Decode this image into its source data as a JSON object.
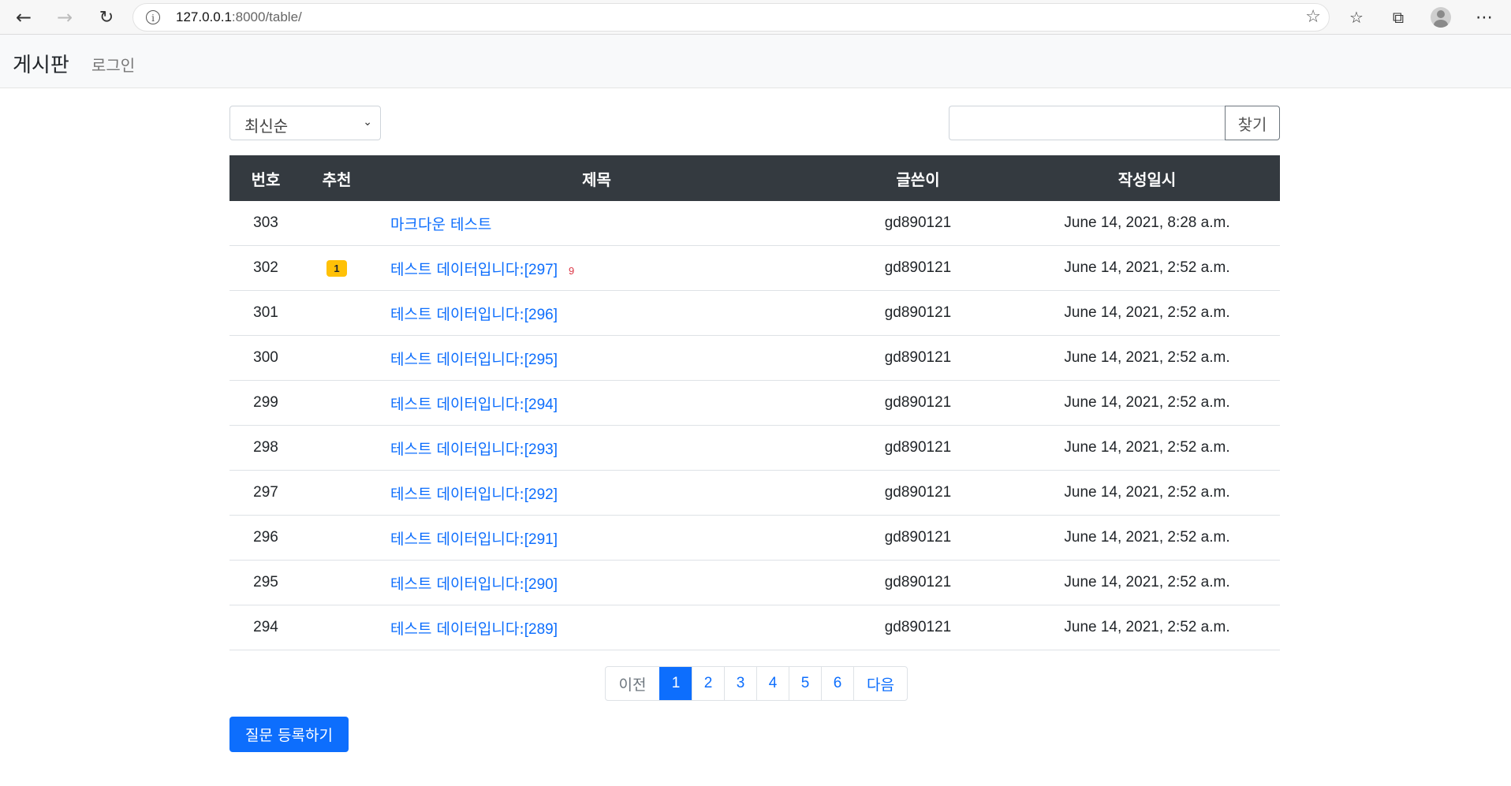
{
  "browser": {
    "url_host": "127.0.0.1",
    "url_path": ":8000/table/",
    "icons": [
      "back-icon",
      "forward-icon",
      "refresh-icon",
      "site-info-icon",
      "favorite-add-icon",
      "favorites-icon",
      "collections-icon",
      "profile-icon",
      "more-icon"
    ]
  },
  "navbar": {
    "brand": "게시판",
    "login": "로그인"
  },
  "controls": {
    "sort_selected": "최신순",
    "search_value": "",
    "search_button": "찾기"
  },
  "table": {
    "headers": [
      "번호",
      "추천",
      "제목",
      "글쓴이",
      "작성일시"
    ],
    "rows": [
      {
        "no": "303",
        "votes": "",
        "title": "마크다운 테스트",
        "title_suffix": "",
        "comments": "",
        "author": "gd890121",
        "date": "June 14, 2021, 8:28 a.m."
      },
      {
        "no": "302",
        "votes": "1",
        "title": "테스트 데이터입니다:",
        "title_suffix": "[297]",
        "comments": "9",
        "author": "gd890121",
        "date": "June 14, 2021, 2:52 a.m."
      },
      {
        "no": "301",
        "votes": "",
        "title": "테스트 데이터입니다:",
        "title_suffix": "[296]",
        "comments": "",
        "author": "gd890121",
        "date": "June 14, 2021, 2:52 a.m."
      },
      {
        "no": "300",
        "votes": "",
        "title": "테스트 데이터입니다:",
        "title_suffix": "[295]",
        "comments": "",
        "author": "gd890121",
        "date": "June 14, 2021, 2:52 a.m."
      },
      {
        "no": "299",
        "votes": "",
        "title": "테스트 데이터입니다:",
        "title_suffix": "[294]",
        "comments": "",
        "author": "gd890121",
        "date": "June 14, 2021, 2:52 a.m."
      },
      {
        "no": "298",
        "votes": "",
        "title": "테스트 데이터입니다:",
        "title_suffix": "[293]",
        "comments": "",
        "author": "gd890121",
        "date": "June 14, 2021, 2:52 a.m."
      },
      {
        "no": "297",
        "votes": "",
        "title": "테스트 데이터입니다:",
        "title_suffix": "[292]",
        "comments": "",
        "author": "gd890121",
        "date": "June 14, 2021, 2:52 a.m."
      },
      {
        "no": "296",
        "votes": "",
        "title": "테스트 데이터입니다:",
        "title_suffix": "[291]",
        "comments": "",
        "author": "gd890121",
        "date": "June 14, 2021, 2:52 a.m."
      },
      {
        "no": "295",
        "votes": "",
        "title": "테스트 데이터입니다:",
        "title_suffix": "[290]",
        "comments": "",
        "author": "gd890121",
        "date": "June 14, 2021, 2:52 a.m."
      },
      {
        "no": "294",
        "votes": "",
        "title": "테스트 데이터입니다:",
        "title_suffix": "[289]",
        "comments": "",
        "author": "gd890121",
        "date": "June 14, 2021, 2:52 a.m."
      }
    ]
  },
  "pagination": {
    "prev": "이전",
    "pages": [
      "1",
      "2",
      "3",
      "4",
      "5",
      "6"
    ],
    "active": "1",
    "next": "다음"
  },
  "register_button": "질문 등록하기",
  "colors": {
    "primary": "#0d6efd",
    "header_dark": "#343a40",
    "badge_warning": "#ffc107",
    "danger": "#dc3545"
  }
}
